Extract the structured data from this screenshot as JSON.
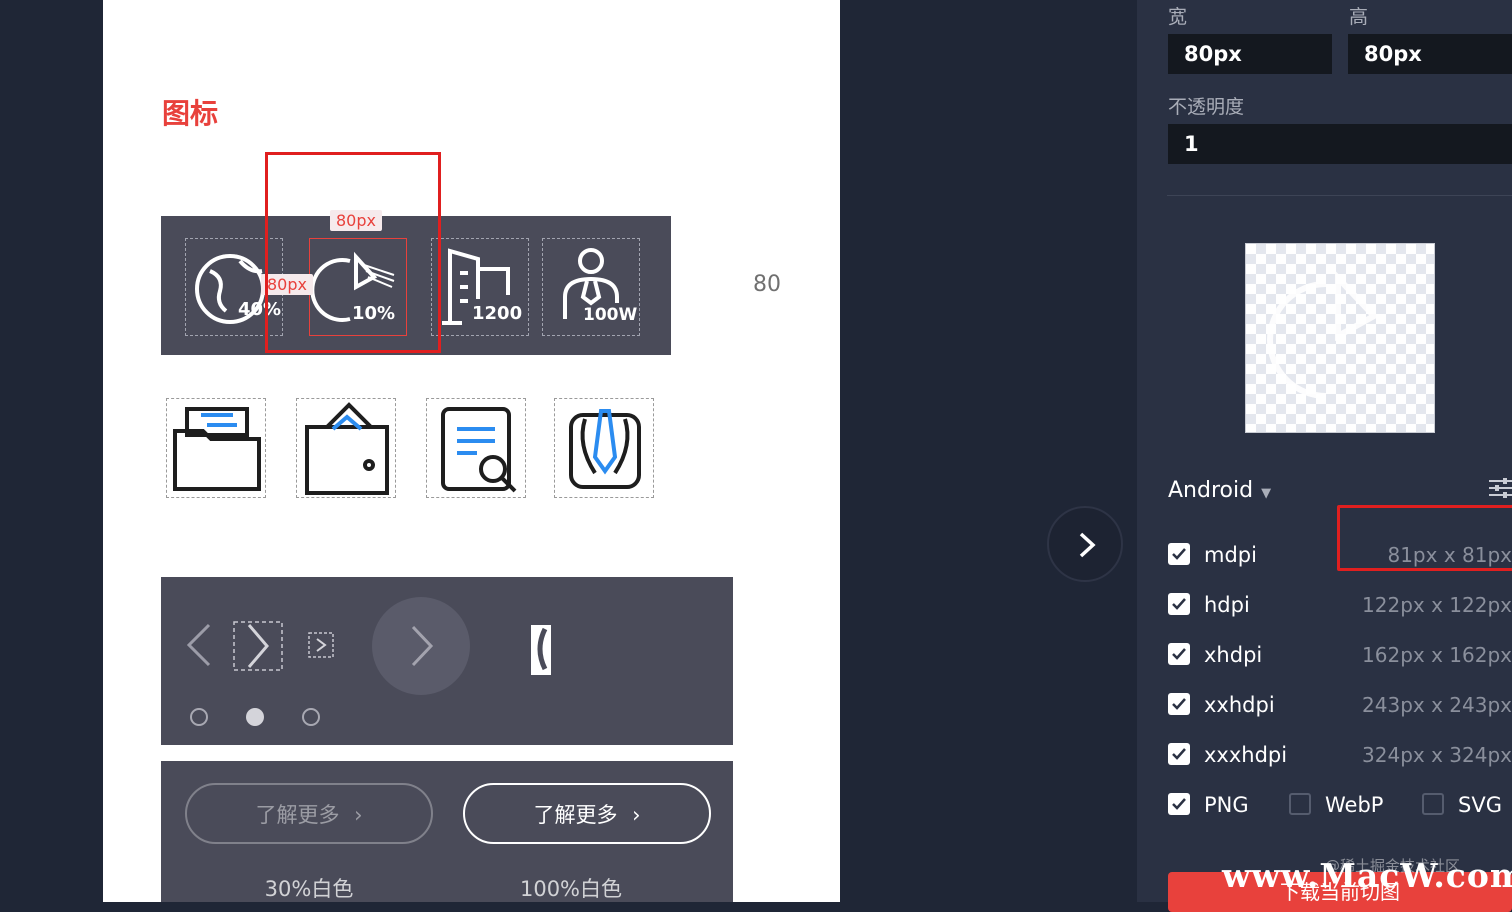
{
  "artboard": {
    "section_title": "图标",
    "size_label_top": "80px",
    "size_label_left": "80px",
    "side_number": "80",
    "dark_icons": [
      {
        "name": "globe-percent-icon",
        "text": "40%"
      },
      {
        "name": "pie-chart-icon",
        "text": "10%"
      },
      {
        "name": "building-icon",
        "text": "1200"
      },
      {
        "name": "user-tie-icon",
        "text": "100W"
      }
    ],
    "light_icons": [
      "folder-icon",
      "wallet-icon",
      "document-search-icon",
      "suit-tie-icon"
    ],
    "buttons": [
      {
        "label": "了解更多",
        "caption": "30%白色"
      },
      {
        "label": "了解更多",
        "caption": "100%白色"
      }
    ]
  },
  "panel": {
    "width_label": "宽",
    "width_value": "80px",
    "height_label": "高",
    "height_value": "80px",
    "opacity_label": "不透明度",
    "opacity_value": "1",
    "platform": "Android",
    "dpi_rows": [
      {
        "name": "mdpi",
        "size": "81px x 81px",
        "checked": true
      },
      {
        "name": "hdpi",
        "size": "122px x 122px",
        "checked": true
      },
      {
        "name": "xhdpi",
        "size": "162px x 162px",
        "checked": true
      },
      {
        "name": "xxhdpi",
        "size": "243px x 243px",
        "checked": true
      },
      {
        "name": "xxxhdpi",
        "size": "324px x 324px",
        "checked": true
      }
    ],
    "formats": [
      {
        "name": "PNG",
        "checked": true
      },
      {
        "name": "WebP",
        "checked": false
      },
      {
        "name": "SVG",
        "checked": false
      }
    ],
    "download_label": "下载当前切图"
  },
  "watermarks": {
    "community": "@稀土掘金技术社区",
    "site": "www.MacW.com"
  },
  "colors": {
    "accent": "#e8413c",
    "panel_bg": "#2a3143",
    "canvas_bg": "#1f2636",
    "strip_bg": "#4a4b59",
    "icon_blue": "#2b8cf0"
  }
}
